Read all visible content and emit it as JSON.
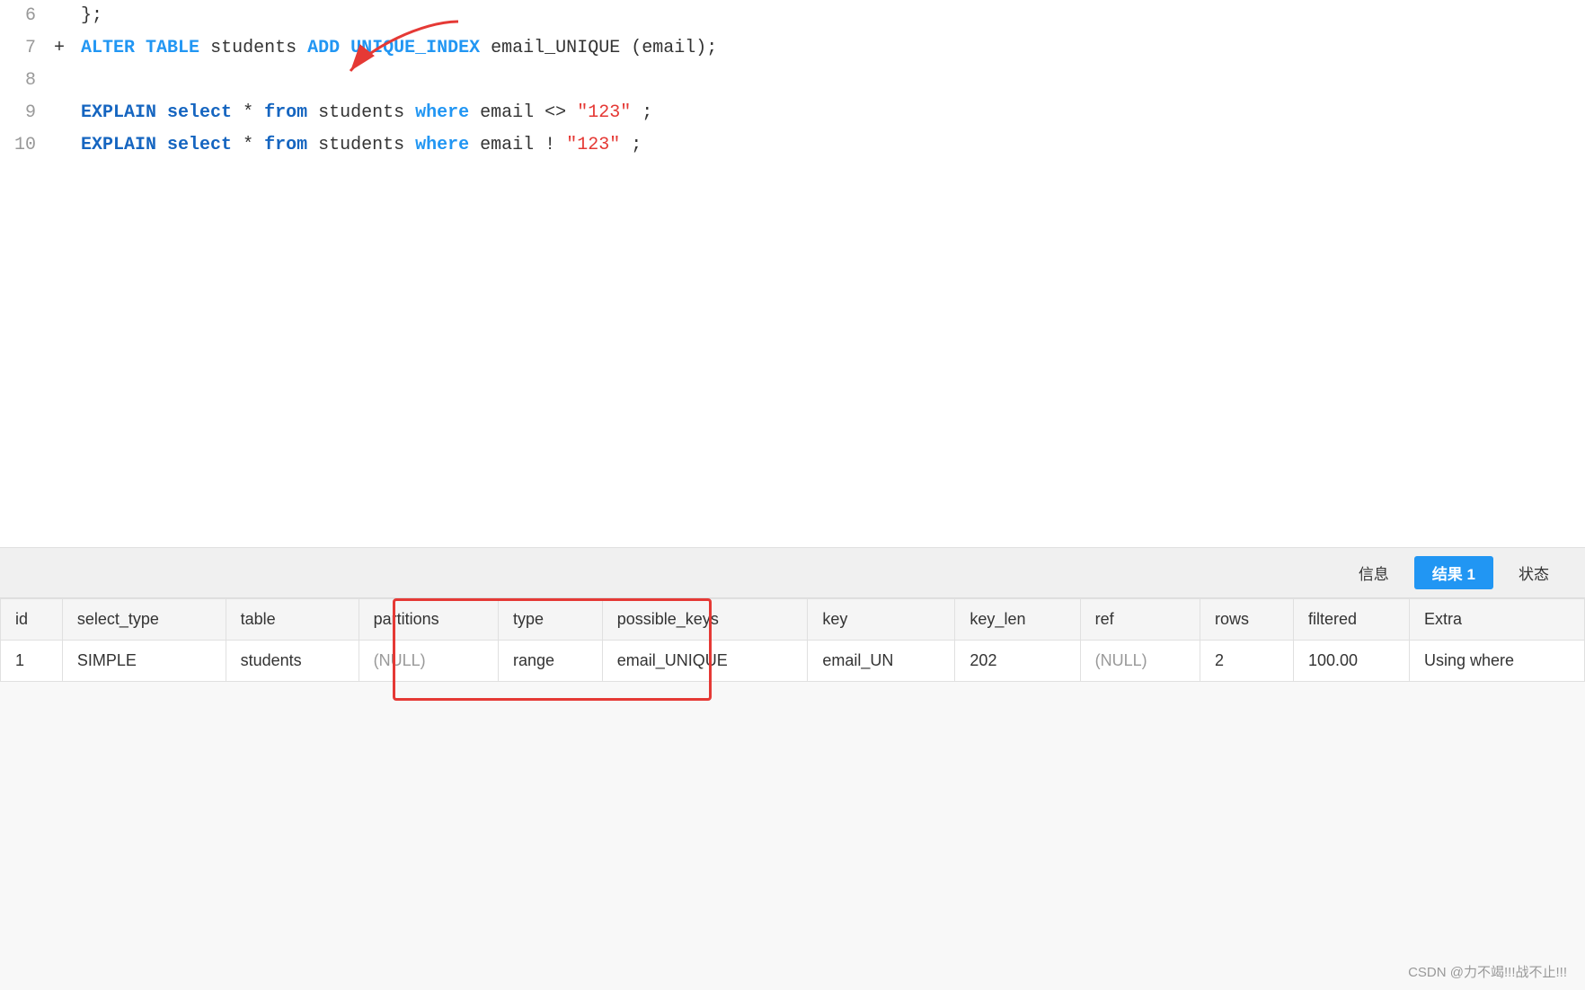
{
  "code": {
    "lines": [
      {
        "num": 6,
        "marker": "",
        "content_parts": [
          {
            "text": "};",
            "class": "text-normal"
          }
        ]
      },
      {
        "num": 7,
        "marker": "+",
        "content_parts": [
          {
            "text": "ALTER",
            "class": "kw-blue"
          },
          {
            "text": " ",
            "class": "text-normal"
          },
          {
            "text": "TABLE",
            "class": "kw-blue"
          },
          {
            "text": " students ",
            "class": "text-normal"
          },
          {
            "text": "ADD",
            "class": "kw-blue"
          },
          {
            "text": " ",
            "class": "text-normal"
          },
          {
            "text": "UNIQUE_INDEX",
            "class": "kw-blue"
          },
          {
            "text": " email_UNIQUE (email);",
            "class": "text-normal"
          }
        ]
      },
      {
        "num": 8,
        "marker": "",
        "content_parts": []
      },
      {
        "num": 9,
        "marker": "",
        "content_parts": [
          {
            "text": "EXPLAIN",
            "class": "kw-explain"
          },
          {
            "text": " ",
            "class": "text-normal"
          },
          {
            "text": "select",
            "class": "kw-select"
          },
          {
            "text": " * ",
            "class": "text-normal"
          },
          {
            "text": "from",
            "class": "kw-from"
          },
          {
            "text": " students ",
            "class": "text-normal"
          },
          {
            "text": "where",
            "class": "kw-where"
          },
          {
            "text": " email <> ",
            "class": "text-normal"
          },
          {
            "text": "\"123\"",
            "class": "text-string"
          },
          {
            "text": ";",
            "class": "text-normal"
          }
        ]
      },
      {
        "num": 10,
        "marker": "",
        "content_parts": [
          {
            "text": "EXPLAIN",
            "class": "kw-explain"
          },
          {
            "text": " ",
            "class": "text-normal"
          },
          {
            "text": "select",
            "class": "kw-select"
          },
          {
            "text": " * ",
            "class": "text-normal"
          },
          {
            "text": "from",
            "class": "kw-from"
          },
          {
            "text": " students ",
            "class": "text-normal"
          },
          {
            "text": "where",
            "class": "kw-where"
          },
          {
            "text": " email ! ",
            "class": "text-normal"
          },
          {
            "text": "\"123\"",
            "class": "text-string"
          },
          {
            "text": ";",
            "class": "text-normal"
          }
        ]
      }
    ]
  },
  "tabs": {
    "items": [
      {
        "label": "信息",
        "active": false
      },
      {
        "label": "结果 1",
        "active": true
      },
      {
        "label": "状态",
        "active": false
      }
    ]
  },
  "table": {
    "headers": [
      "id",
      "select_type",
      "table",
      "partitions",
      "type",
      "possible_keys",
      "key",
      "key_len",
      "ref",
      "rows",
      "filtered",
      "Extra"
    ],
    "rows": [
      [
        "1",
        "SIMPLE",
        "students",
        "(NULL)",
        "range",
        "email_UNIQUE",
        "email_UN",
        "202",
        "(NULL)",
        "2",
        "100.00",
        "Using where"
      ]
    ]
  },
  "footer": {
    "watermark": "CSDN @力不竭!!!战不止!!!"
  }
}
